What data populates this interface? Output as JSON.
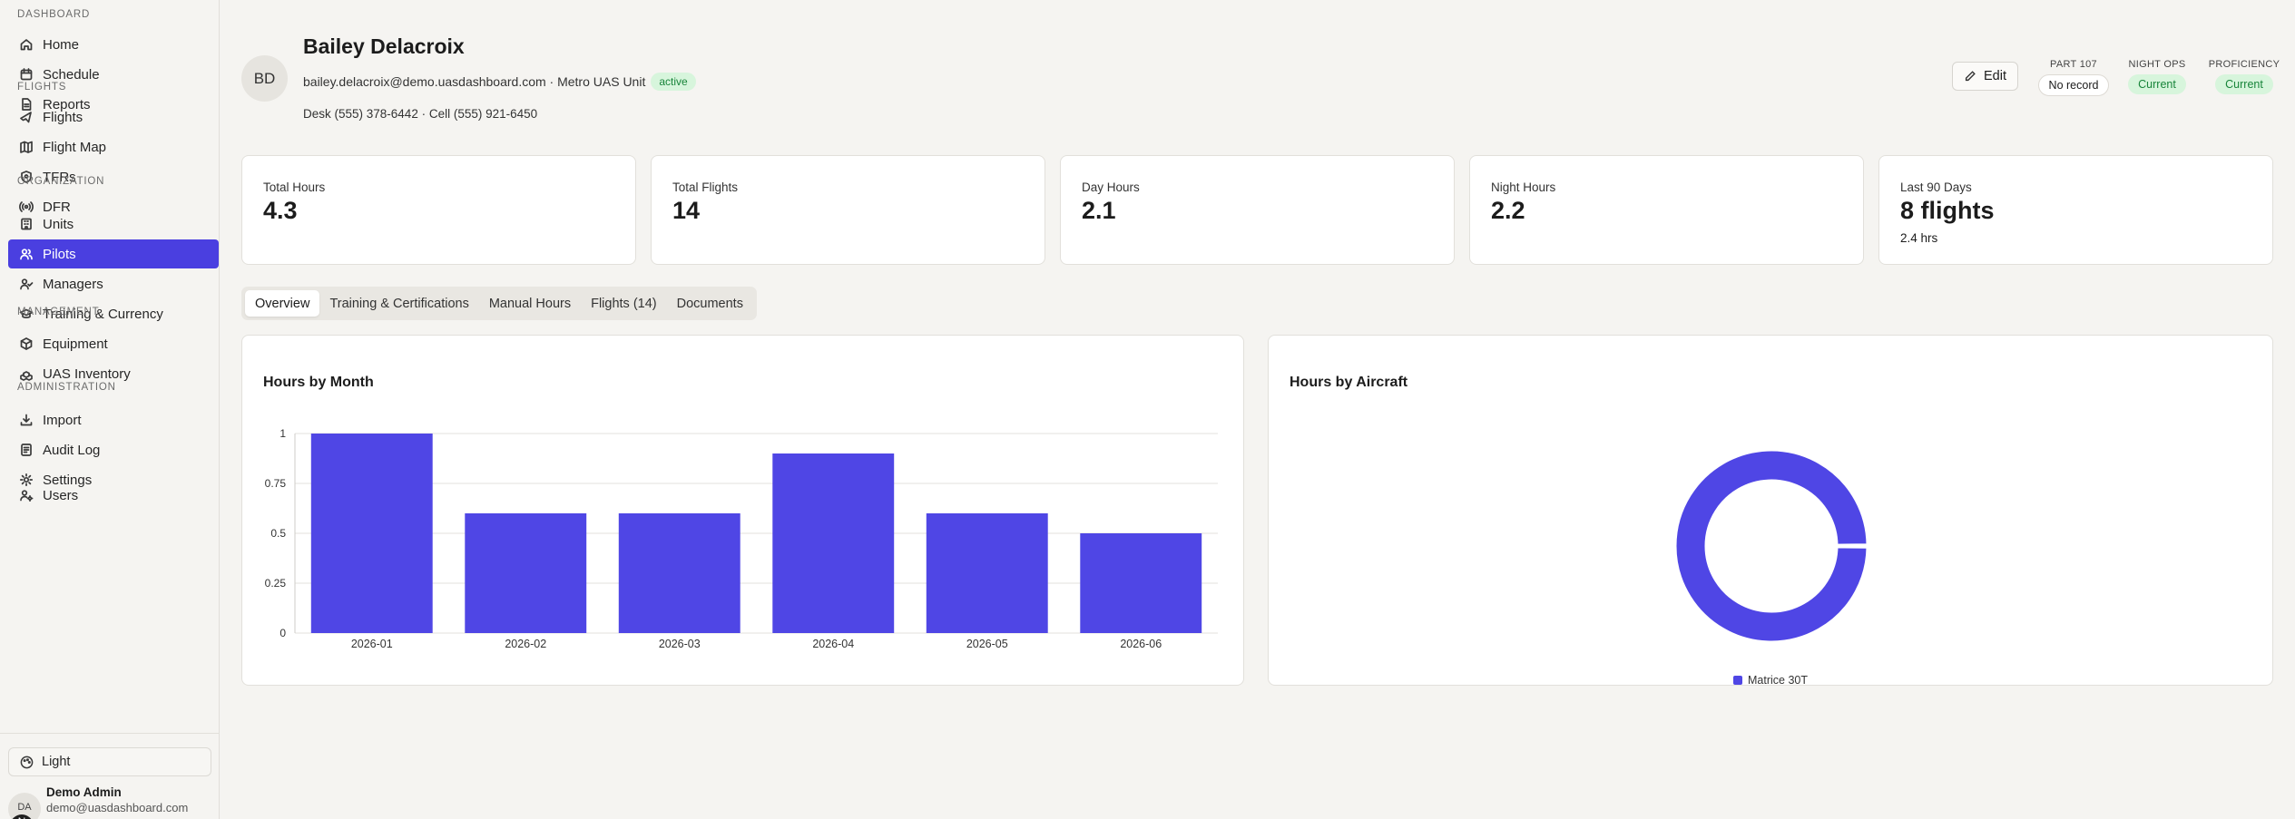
{
  "sidebar": {
    "sections": [
      {
        "label": "DASHBOARD",
        "items": [
          {
            "label": "Home",
            "icon": "home-icon"
          },
          {
            "label": "Schedule",
            "icon": "calendar-icon"
          },
          {
            "label": "Reports",
            "icon": "report-icon"
          }
        ]
      },
      {
        "label": "FLIGHTS",
        "items": [
          {
            "label": "Flights",
            "icon": "plane-icon"
          },
          {
            "label": "Flight Map",
            "icon": "map-icon"
          },
          {
            "label": "TFRs",
            "icon": "shield-icon"
          },
          {
            "label": "DFR",
            "icon": "broadcast-icon"
          }
        ]
      },
      {
        "label": "ORGANIZATION",
        "items": [
          {
            "label": "Units",
            "icon": "building-icon"
          },
          {
            "label": "Pilots",
            "icon": "users-icon",
            "active": true
          },
          {
            "label": "Managers",
            "icon": "user-check-icon"
          },
          {
            "label": "Training & Currency",
            "icon": "graduation-cap-icon"
          },
          {
            "label": "Equipment",
            "icon": "box-icon"
          },
          {
            "label": "UAS Inventory",
            "icon": "boxes-icon"
          }
        ]
      },
      {
        "label": "MANAGEMENT",
        "items": [
          {
            "label": "Import",
            "icon": "download-icon"
          },
          {
            "label": "Audit Log",
            "icon": "log-icon"
          },
          {
            "label": "Settings",
            "icon": "gear-icon"
          }
        ]
      },
      {
        "label": "ADMINISTRATION",
        "items": [
          {
            "label": "Users",
            "icon": "user-cog-icon"
          }
        ]
      }
    ],
    "theme_label": "Light",
    "user": {
      "initials": "DA",
      "badge": "N",
      "name": "Demo Admin",
      "email": "demo@uasdashboard.com"
    }
  },
  "profile": {
    "initials": "BD",
    "name": "Bailey Delacroix",
    "email_unit": "bailey.delacroix@demo.uasdashboard.com · Metro UAS Unit",
    "status": "active",
    "phones": "Desk (555) 378-6442 · Cell (555) 921-6450",
    "edit_label": "Edit",
    "statuses": [
      {
        "label": "PART 107",
        "value": "No record",
        "tone": "neutral"
      },
      {
        "label": "NIGHT OPS",
        "value": "Current",
        "tone": "green"
      },
      {
        "label": "PROFICIENCY",
        "value": "Current",
        "tone": "green"
      }
    ]
  },
  "stats": [
    {
      "label": "Total Hours",
      "value": "4.3",
      "sub": ""
    },
    {
      "label": "Total Flights",
      "value": "14",
      "sub": ""
    },
    {
      "label": "Day Hours",
      "value": "2.1",
      "sub": ""
    },
    {
      "label": "Night Hours",
      "value": "2.2",
      "sub": ""
    },
    {
      "label": "Last 90 Days",
      "value": "8 flights",
      "sub": "2.4 hrs"
    }
  ],
  "tabs": [
    {
      "label": "Overview",
      "active": true
    },
    {
      "label": "Training & Certifications"
    },
    {
      "label": "Manual Hours"
    },
    {
      "label": "Flights (14)"
    },
    {
      "label": "Documents"
    }
  ],
  "accent_color": "#4f46e5",
  "chart_data": [
    {
      "type": "bar",
      "title": "Hours by Month",
      "categories": [
        "2026-01",
        "2026-02",
        "2026-03",
        "2026-04",
        "2026-05",
        "2026-06"
      ],
      "values": [
        1.0,
        0.6,
        0.6,
        0.9,
        0.6,
        0.5
      ],
      "ylim": [
        0,
        1
      ],
      "yticks": [
        "0",
        "0.25",
        "0.5",
        "0.75",
        "1"
      ],
      "grid": true
    },
    {
      "type": "pie",
      "title": "Hours by Aircraft",
      "labels": [
        "Matrice 30T"
      ],
      "values": [
        4.3
      ],
      "legend": "bottom"
    }
  ]
}
